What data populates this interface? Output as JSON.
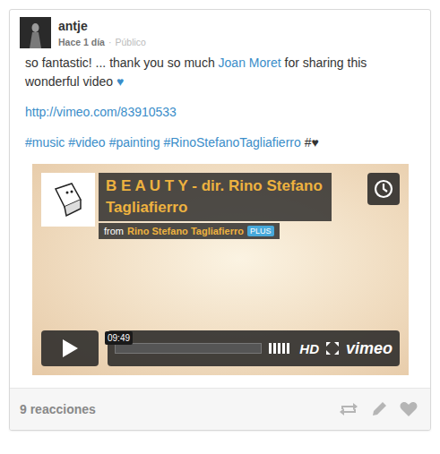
{
  "post": {
    "author": "antje",
    "time": "Hace 1 día",
    "separator": "·",
    "visibility": "Público",
    "body": [
      {
        "text": "so fantastic! ... thank you so much ",
        "kind": "text"
      },
      {
        "text": "Joan Moret",
        "kind": "link"
      },
      {
        "text": " for sharing this wonderful video ",
        "kind": "text"
      },
      {
        "text": "♥",
        "kind": "link"
      }
    ],
    "url": "http://vimeo.com/83910533",
    "hashtags": [
      {
        "text": "#music",
        "kind": "link"
      },
      {
        "text": "#video",
        "kind": "link"
      },
      {
        "text": "#painting",
        "kind": "link"
      },
      {
        "text": "#RinoStefanoTagliafierro",
        "kind": "link"
      },
      {
        "text": "#♥",
        "kind": "text"
      }
    ]
  },
  "video": {
    "title": "B E A U T Y - dir. Rino Stefano Tagliafierro",
    "from_label": "from",
    "channel": "Rino Stefano Tagliafierro",
    "badge": "PLUS",
    "duration": "09:49",
    "quality": "HD",
    "brand": "vimeo",
    "playing": false
  },
  "footer": {
    "reactions": "9 reacciones"
  }
}
